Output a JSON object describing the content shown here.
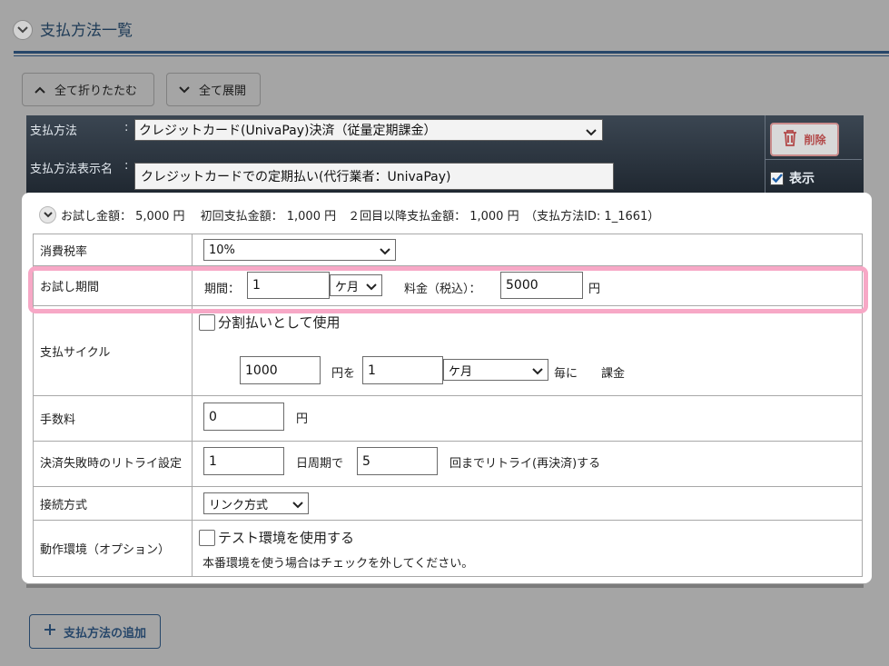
{
  "header": {
    "title": "支払方法一覧"
  },
  "toolbar": {
    "collapse_all": "全て折りたたむ",
    "expand_all": "全て展開"
  },
  "method": {
    "method_label": "支払方法",
    "method_sep": ":",
    "method_value": "クレジットカード(UnivaPay)決済（従量定期課金）",
    "display_name_label": "支払方法表示名",
    "display_name_sep": ":",
    "display_name_value": "クレジットカードでの定期払い(代行業者：UnivaPay)",
    "delete_label": "削除",
    "show_label": "表示",
    "show_checked": true
  },
  "summary": "お試し金額： 5,000 円　 初回支払金額： 1,000 円　２回目以降支払金額： 1,000 円　（支払方法ID: 1_1661）",
  "rows": {
    "tax": {
      "label": "消費税率",
      "value": "10%"
    },
    "trial": {
      "label": "お試し期間",
      "period_label": "期間：",
      "period_value": "1",
      "period_unit": "ケ月",
      "fee_label": "料金（税込）：",
      "fee_value": "5000",
      "fee_unit": "円"
    },
    "cycle": {
      "label": "支払サイクル",
      "installment_label": "分割払いとして使用",
      "amount_value": "1000",
      "amount_suffix": "円を",
      "count_value": "1",
      "unit_value": "ケ月",
      "every_label": "毎に",
      "charge_label": "課金"
    },
    "fee": {
      "label": "手数料",
      "value": "0",
      "unit": "円"
    },
    "retry": {
      "label": "決済失敗時のリトライ設定",
      "interval_value": "1",
      "interval_suffix": "日周期で",
      "times_value": "5",
      "times_suffix": "回までリトライ(再決済)する"
    },
    "connection": {
      "label": "接続方式",
      "value": "リンク方式"
    },
    "environment": {
      "label": "動作環境（オプション）",
      "test_label": "テスト環境を使用する",
      "note": "本番環境を使う場合はチェックを外してください。"
    }
  },
  "add_button": "支払方法の追加",
  "colors": {
    "background": "#a5a5a5",
    "accent": "#27476a",
    "highlight": "#f7a8c6",
    "delete": "#b24848"
  }
}
